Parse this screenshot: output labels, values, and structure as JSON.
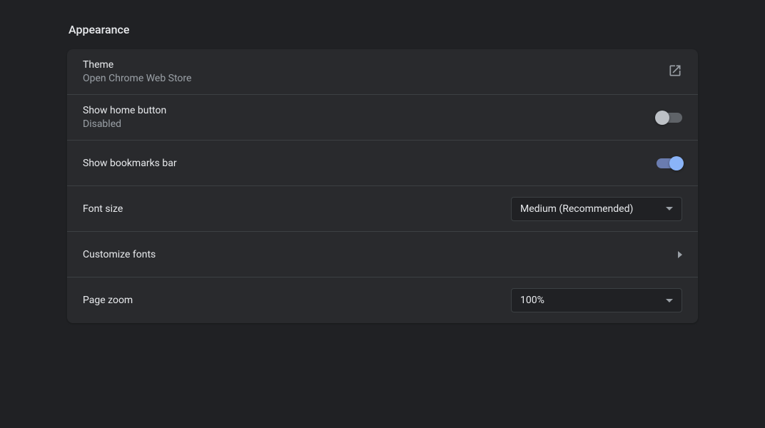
{
  "section": {
    "title": "Appearance"
  },
  "theme": {
    "title": "Theme",
    "subtitle": "Open Chrome Web Store"
  },
  "homeButton": {
    "title": "Show home button",
    "status": "Disabled",
    "enabled": false
  },
  "bookmarksBar": {
    "title": "Show bookmarks bar",
    "enabled": true
  },
  "fontSize": {
    "title": "Font size",
    "value": "Medium (Recommended)"
  },
  "customizeFonts": {
    "title": "Customize fonts"
  },
  "pageZoom": {
    "title": "Page zoom",
    "value": "100%"
  }
}
